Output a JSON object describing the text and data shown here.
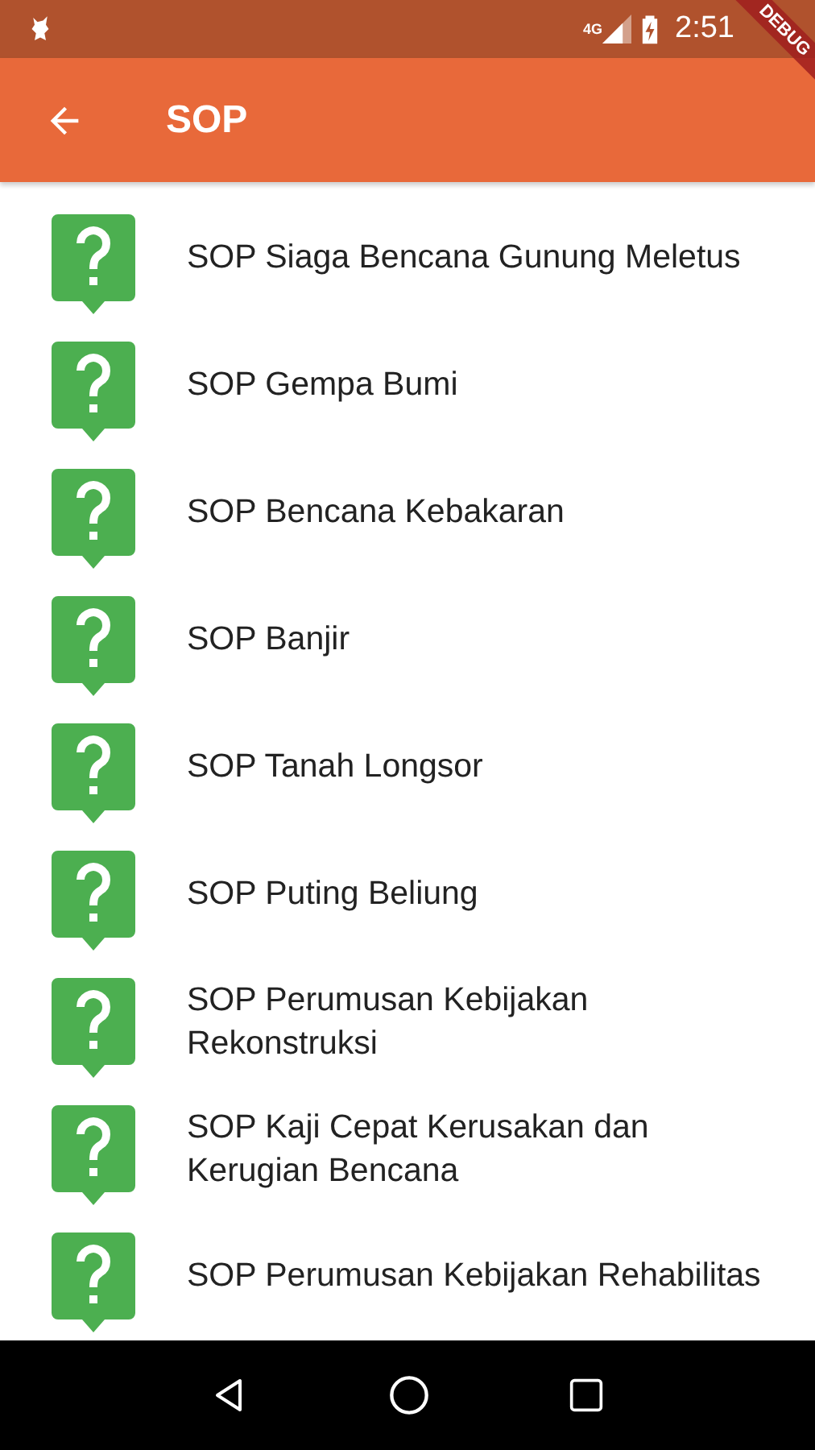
{
  "status_bar": {
    "time": "2:51",
    "network": "4G"
  },
  "debug_banner": "DEBUG",
  "app_bar": {
    "title": "SOP"
  },
  "items": [
    {
      "label": "SOP Siaga Bencana Gunung Meletus"
    },
    {
      "label": "SOP Gempa Bumi"
    },
    {
      "label": "SOP Bencana Kebakaran"
    },
    {
      "label": "SOP Banjir"
    },
    {
      "label": "SOP Tanah Longsor"
    },
    {
      "label": "SOP Puting Beliung"
    },
    {
      "label": "SOP Perumusan Kebijakan Rekonstruksi"
    },
    {
      "label": "SOP Kaji Cepat Kerusakan dan Kerugian Bencana"
    },
    {
      "label": "SOP Perumusan Kebijakan Rehabilitas"
    }
  ]
}
